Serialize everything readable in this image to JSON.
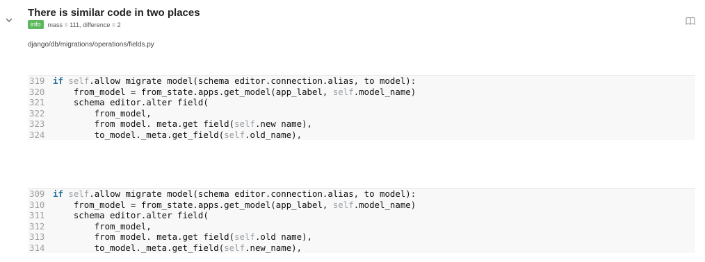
{
  "issue": {
    "title": "There is similar code in two places",
    "badge": "info",
    "meta_text": "mass = 111, difference = 2",
    "file_path": "django/db/migrations/operations/fields.py"
  },
  "icons": {
    "collapse": "chevron-down-icon",
    "docs": "book-icon"
  },
  "colors": {
    "badge": "#5cb85c",
    "keyword": "#2a6f9b",
    "self": "#9aa0a6",
    "line_number": "#9e9e9e"
  },
  "blocks": [
    {
      "lines": [
        {
          "num": "319",
          "segments": [
            [
              "kw",
              "if"
            ],
            [
              "txt",
              " "
            ],
            [
              "sf",
              "self"
            ],
            [
              "txt",
              ".allow migrate model(schema editor.connection.alias, to model):"
            ]
          ]
        },
        {
          "num": "320",
          "segments": [
            [
              "txt",
              "    from_model = from_state.apps.get_model(app_label, "
            ],
            [
              "sf",
              "self"
            ],
            [
              "txt",
              ".model_name)"
            ]
          ]
        },
        {
          "num": "321",
          "segments": [
            [
              "txt",
              "    schema editor.alter field("
            ]
          ]
        },
        {
          "num": "322",
          "segments": [
            [
              "txt",
              "        from_model,"
            ]
          ]
        },
        {
          "num": "323",
          "segments": [
            [
              "txt",
              "        from model. meta.get field("
            ],
            [
              "sf",
              "self"
            ],
            [
              "txt",
              ".new name),"
            ]
          ]
        },
        {
          "num": "324",
          "segments": [
            [
              "txt",
              "        to_model._meta.get_field("
            ],
            [
              "sf",
              "self"
            ],
            [
              "txt",
              ".old_name),"
            ]
          ]
        }
      ]
    },
    {
      "lines": [
        {
          "num": "309",
          "segments": [
            [
              "kw",
              "if"
            ],
            [
              "txt",
              " "
            ],
            [
              "sf",
              "self"
            ],
            [
              "txt",
              ".allow migrate model(schema editor.connection.alias, to model):"
            ]
          ]
        },
        {
          "num": "310",
          "segments": [
            [
              "txt",
              "    from_model = from_state.apps.get_model(app_label, "
            ],
            [
              "sf",
              "self"
            ],
            [
              "txt",
              ".model_name)"
            ]
          ]
        },
        {
          "num": "311",
          "segments": [
            [
              "txt",
              "    schema editor.alter field("
            ]
          ]
        },
        {
          "num": "312",
          "segments": [
            [
              "txt",
              "        from_model,"
            ]
          ]
        },
        {
          "num": "313",
          "segments": [
            [
              "txt",
              "        from model. meta.get field("
            ],
            [
              "sf",
              "self"
            ],
            [
              "txt",
              ".old name),"
            ]
          ]
        },
        {
          "num": "314",
          "segments": [
            [
              "txt",
              "        to_model._meta.get_field("
            ],
            [
              "sf",
              "self"
            ],
            [
              "txt",
              ".new_name),"
            ]
          ]
        }
      ]
    }
  ]
}
